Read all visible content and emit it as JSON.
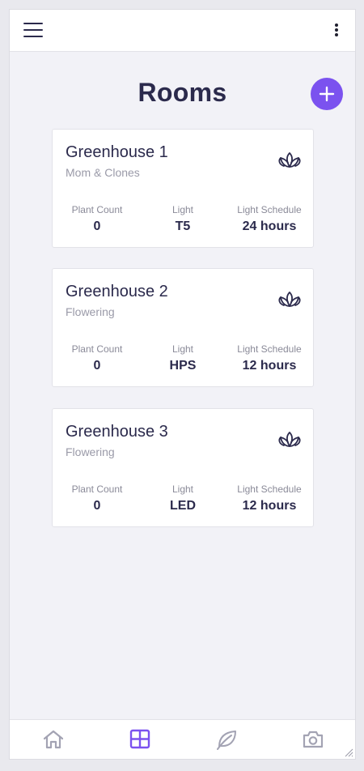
{
  "header": {
    "menu_icon": "hamburger-menu-icon",
    "more_icon": "more-vertical-icon"
  },
  "page": {
    "title": "Rooms",
    "add_icon": "plus-icon"
  },
  "colors": {
    "accent": "#7b52ef",
    "text_dark": "#2b2a4c",
    "text_muted": "#9a9aa8",
    "background": "#f2f2f7",
    "nav_inactive": "#a3a3b3"
  },
  "rooms": [
    {
      "name": "Greenhouse 1",
      "type": "Mom & Clones",
      "icon": "lotus-icon",
      "stats": [
        {
          "label": "Plant Count",
          "value": "0"
        },
        {
          "label": "Light",
          "value": "T5"
        },
        {
          "label": "Light Schedule",
          "value": "24 hours"
        }
      ]
    },
    {
      "name": "Greenhouse 2",
      "type": "Flowering",
      "icon": "lotus-icon",
      "stats": [
        {
          "label": "Plant Count",
          "value": "0"
        },
        {
          "label": "Light",
          "value": "HPS"
        },
        {
          "label": "Light Schedule",
          "value": "12 hours"
        }
      ]
    },
    {
      "name": "Greenhouse 3",
      "type": "Flowering",
      "icon": "lotus-icon",
      "stats": [
        {
          "label": "Plant Count",
          "value": "0"
        },
        {
          "label": "Light",
          "value": "LED"
        },
        {
          "label": "Light Schedule",
          "value": "12 hours"
        }
      ]
    }
  ],
  "bottom_nav": {
    "items": [
      {
        "icon": "home-icon",
        "active": false
      },
      {
        "icon": "rooms-grid-icon",
        "active": true
      },
      {
        "icon": "leaf-icon",
        "active": false
      },
      {
        "icon": "camera-icon",
        "active": false
      }
    ]
  }
}
